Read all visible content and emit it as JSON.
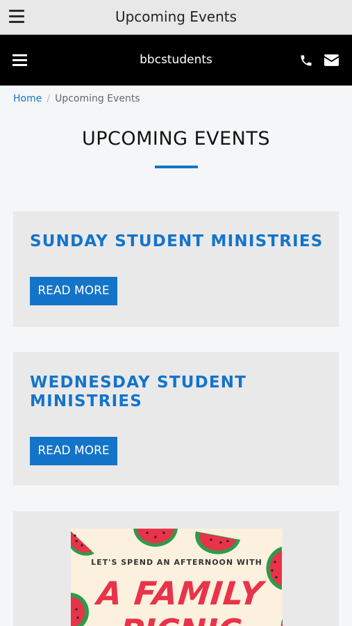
{
  "app_bar": {
    "title": "Upcoming Events"
  },
  "site_bar": {
    "brand": "bbcstudents"
  },
  "breadcrumb": {
    "home": "Home",
    "separator": "/",
    "current": "Upcoming Events"
  },
  "page": {
    "heading": "UPCOMING EVENTS"
  },
  "events": [
    {
      "title": "SUNDAY STUDENT MINISTRIES",
      "button": "READ MORE"
    },
    {
      "title": "WEDNESDAY STUDENT MINISTRIES",
      "button": "READ MORE"
    }
  ],
  "flyer": {
    "subtitle": "LET'S SPEND AN AFTERNOON WITH",
    "headline": "A FAMILY",
    "headline_2": "PICNIC"
  },
  "colors": {
    "accent": "#1474c9",
    "site_bar_bg": "#000000",
    "flyer_red": "#e8334a"
  },
  "icons": [
    "hamburger-menu-icon",
    "phone-icon",
    "mail-icon"
  ]
}
